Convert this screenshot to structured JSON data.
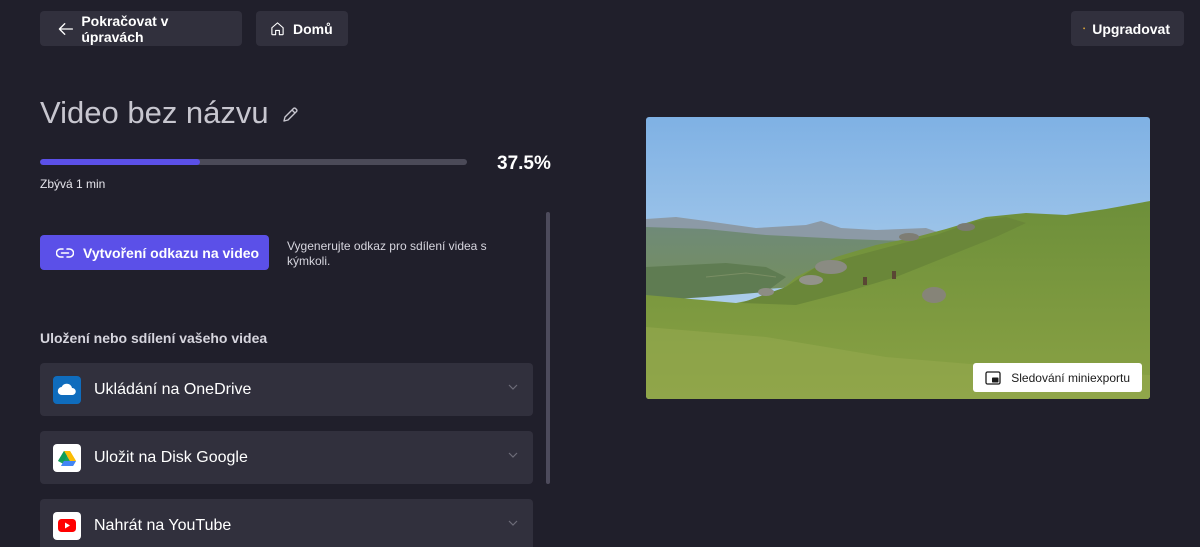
{
  "topbar": {
    "back_label": "Pokračovat v úpravách",
    "home_label": "Domů",
    "upgrade_label": "Upgradovat"
  },
  "export": {
    "title": "Video bez názvu",
    "progress_percent": 37.5,
    "progress_label": "37.5%",
    "remaining_label": "Zbývá 1 min"
  },
  "link": {
    "button_label": "Vytvoření odkazu na video",
    "description": "Vygenerujte odkaz pro sdílení videa s kýmkoli."
  },
  "share": {
    "heading": "Uložení nebo sdílení vašeho videa",
    "items": [
      {
        "label": "Ukládání na OneDrive",
        "icon": "onedrive-icon",
        "color": "#0f6cbd"
      },
      {
        "label": "Uložit na Disk Google",
        "icon": "google-drive-icon",
        "color": "#ffffff"
      },
      {
        "label": "Nahrát na YouTube",
        "icon": "youtube-icon",
        "color": "#ff0000"
      }
    ]
  },
  "preview": {
    "mini_export_label": "Sledování miniexportu"
  },
  "colors": {
    "background": "#201f2b",
    "accent": "#5b50e8",
    "button": "#31303d"
  }
}
